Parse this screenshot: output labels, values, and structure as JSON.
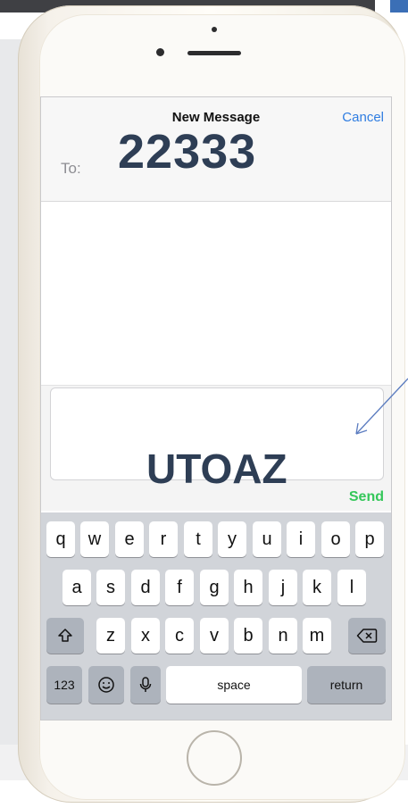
{
  "header": {
    "title": "New Message",
    "cancel_label": "Cancel"
  },
  "recipient": {
    "label": "To:",
    "value": "22333"
  },
  "compose": {
    "text": "UTOAZ",
    "send_label": "Send"
  },
  "keyboard": {
    "row1": [
      "q",
      "w",
      "e",
      "r",
      "t",
      "y",
      "u",
      "i",
      "o",
      "p"
    ],
    "row2": [
      "a",
      "s",
      "d",
      "f",
      "g",
      "h",
      "j",
      "k",
      "l"
    ],
    "row3": [
      "z",
      "x",
      "c",
      "v",
      "b",
      "n",
      "m"
    ],
    "shift_icon": "shift-icon",
    "delete_icon": "delete-icon",
    "numbers_label": "123",
    "emoji_icon": "emoji-icon",
    "mic_icon": "microphone-icon",
    "space_label": "space",
    "return_label": "return"
  },
  "colors": {
    "accent_blue": "#2f7de1",
    "send_green": "#34c759",
    "overlay_text": "#2e3e55"
  }
}
